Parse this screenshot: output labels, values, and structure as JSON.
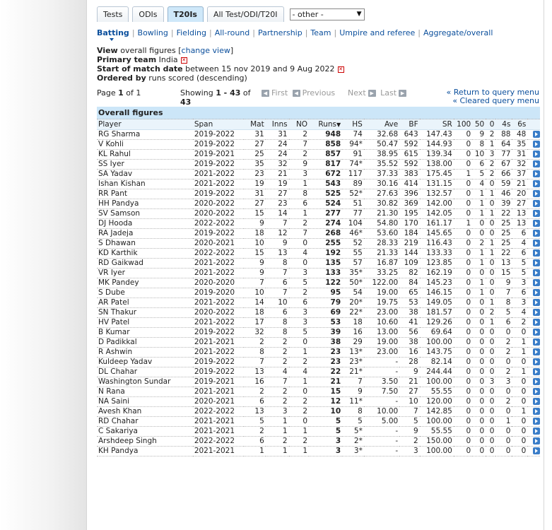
{
  "tabs": [
    "Tests",
    "ODIs",
    "T20Is",
    "All Test/ODI/T20I"
  ],
  "active_tab": "T20Is",
  "select": {
    "value": "- other -"
  },
  "subnav": [
    "Batting",
    "Bowling",
    "Fielding",
    "All-round",
    "Partnership",
    "Team",
    "Umpire and referee",
    "Aggregate/overall"
  ],
  "meta": {
    "view_label": "View",
    "view_text": " overall figures [",
    "change_view": "change view",
    "view_close": "]",
    "team_label": "Primary team",
    "team_value": " India",
    "date_label": "Start of match date",
    "date_value": " between 15 nov 2019 and 9 Aug 2022",
    "order_label": "Ordered by",
    "order_value": " runs scored (descending)"
  },
  "pager": {
    "page_prefix": "Page ",
    "page": "1",
    "of": " of ",
    "total_pages": "1",
    "showing_prefix": "Showing ",
    "showing_range": "1 - 43",
    "showing_of": " of ",
    "showing_total": "43",
    "first": "First",
    "previous": "Previous",
    "next": "Next",
    "last": "Last",
    "return": "Return to query menu",
    "cleared": "Cleared query menu"
  },
  "table": {
    "caption": "Overall figures",
    "headers": [
      "Player",
      "Span",
      "Mat",
      "Inns",
      "NO",
      "Runs",
      "HS",
      "Ave",
      "BF",
      "SR",
      "100",
      "50",
      "0",
      "4s",
      "6s"
    ],
    "rows": [
      [
        "RG Sharma",
        "2019-2022",
        "31",
        "31",
        "2",
        "948",
        "74",
        "32.68",
        "643",
        "147.43",
        "0",
        "9",
        "2",
        "88",
        "48"
      ],
      [
        "V Kohli",
        "2019-2022",
        "27",
        "24",
        "7",
        "858",
        "94*",
        "50.47",
        "592",
        "144.93",
        "0",
        "8",
        "1",
        "64",
        "35"
      ],
      [
        "KL Rahul",
        "2019-2021",
        "25",
        "24",
        "2",
        "857",
        "91",
        "38.95",
        "615",
        "139.34",
        "0",
        "10",
        "3",
        "77",
        "31"
      ],
      [
        "SS Iyer",
        "2019-2022",
        "35",
        "32",
        "9",
        "817",
        "74*",
        "35.52",
        "592",
        "138.00",
        "0",
        "6",
        "2",
        "67",
        "32"
      ],
      [
        "SA Yadav",
        "2021-2022",
        "23",
        "21",
        "3",
        "672",
        "117",
        "37.33",
        "383",
        "175.45",
        "1",
        "5",
        "2",
        "66",
        "37"
      ],
      [
        "Ishan Kishan",
        "2021-2022",
        "19",
        "19",
        "1",
        "543",
        "89",
        "30.16",
        "414",
        "131.15",
        "0",
        "4",
        "0",
        "59",
        "21"
      ],
      [
        "RR Pant",
        "2019-2022",
        "31",
        "27",
        "8",
        "525",
        "52*",
        "27.63",
        "396",
        "132.57",
        "0",
        "1",
        "1",
        "46",
        "20"
      ],
      [
        "HH Pandya",
        "2020-2022",
        "27",
        "23",
        "6",
        "524",
        "51",
        "30.82",
        "369",
        "142.00",
        "0",
        "1",
        "0",
        "39",
        "27"
      ],
      [
        "SV Samson",
        "2020-2022",
        "15",
        "14",
        "1",
        "277",
        "77",
        "21.30",
        "195",
        "142.05",
        "0",
        "1",
        "1",
        "22",
        "13"
      ],
      [
        "DJ Hooda",
        "2022-2022",
        "9",
        "7",
        "2",
        "274",
        "104",
        "54.80",
        "170",
        "161.17",
        "1",
        "0",
        "0",
        "25",
        "13"
      ],
      [
        "RA Jadeja",
        "2019-2022",
        "18",
        "12",
        "7",
        "268",
        "46*",
        "53.60",
        "184",
        "145.65",
        "0",
        "0",
        "0",
        "25",
        "6"
      ],
      [
        "S Dhawan",
        "2020-2021",
        "10",
        "9",
        "0",
        "255",
        "52",
        "28.33",
        "219",
        "116.43",
        "0",
        "2",
        "1",
        "25",
        "4"
      ],
      [
        "KD Karthik",
        "2022-2022",
        "15",
        "13",
        "4",
        "192",
        "55",
        "21.33",
        "144",
        "133.33",
        "0",
        "1",
        "1",
        "22",
        "6"
      ],
      [
        "RD Gaikwad",
        "2021-2022",
        "9",
        "8",
        "0",
        "135",
        "57",
        "16.87",
        "109",
        "123.85",
        "0",
        "1",
        "0",
        "13",
        "5"
      ],
      [
        "VR Iyer",
        "2021-2022",
        "9",
        "7",
        "3",
        "133",
        "35*",
        "33.25",
        "82",
        "162.19",
        "0",
        "0",
        "0",
        "15",
        "5"
      ],
      [
        "MK Pandey",
        "2020-2020",
        "7",
        "6",
        "5",
        "122",
        "50*",
        "122.00",
        "84",
        "145.23",
        "0",
        "1",
        "0",
        "9",
        "3"
      ],
      [
        "S Dube",
        "2019-2020",
        "10",
        "7",
        "2",
        "95",
        "54",
        "19.00",
        "65",
        "146.15",
        "0",
        "1",
        "0",
        "7",
        "6"
      ],
      [
        "AR Patel",
        "2021-2022",
        "14",
        "10",
        "6",
        "79",
        "20*",
        "19.75",
        "53",
        "149.05",
        "0",
        "0",
        "1",
        "8",
        "3"
      ],
      [
        "SN Thakur",
        "2020-2022",
        "18",
        "6",
        "3",
        "69",
        "22*",
        "23.00",
        "38",
        "181.57",
        "0",
        "0",
        "2",
        "5",
        "4"
      ],
      [
        "HV Patel",
        "2021-2022",
        "17",
        "8",
        "3",
        "53",
        "18",
        "10.60",
        "41",
        "129.26",
        "0",
        "0",
        "1",
        "6",
        "2"
      ],
      [
        "B Kumar",
        "2019-2022",
        "32",
        "8",
        "5",
        "39",
        "16",
        "13.00",
        "56",
        "69.64",
        "0",
        "0",
        "0",
        "0",
        "0"
      ],
      [
        "D Padikkal",
        "2021-2021",
        "2",
        "2",
        "0",
        "38",
        "29",
        "19.00",
        "38",
        "100.00",
        "0",
        "0",
        "0",
        "2",
        "1"
      ],
      [
        "R Ashwin",
        "2021-2022",
        "8",
        "2",
        "1",
        "23",
        "13*",
        "23.00",
        "16",
        "143.75",
        "0",
        "0",
        "0",
        "2",
        "1"
      ],
      [
        "Kuldeep Yadav",
        "2019-2022",
        "7",
        "2",
        "2",
        "23",
        "23*",
        "-",
        "28",
        "82.14",
        "0",
        "0",
        "0",
        "0",
        "0"
      ],
      [
        "DL Chahar",
        "2019-2022",
        "13",
        "4",
        "4",
        "22",
        "21*",
        "-",
        "9",
        "244.44",
        "0",
        "0",
        "0",
        "2",
        "1"
      ],
      [
        "Washington Sundar",
        "2019-2021",
        "16",
        "7",
        "1",
        "21",
        "7",
        "3.50",
        "21",
        "100.00",
        "0",
        "0",
        "3",
        "3",
        "0"
      ],
      [
        "N Rana",
        "2021-2021",
        "2",
        "2",
        "0",
        "15",
        "9",
        "7.50",
        "27",
        "55.55",
        "0",
        "0",
        "0",
        "0",
        "0"
      ],
      [
        "NA Saini",
        "2020-2021",
        "6",
        "2",
        "2",
        "12",
        "11*",
        "-",
        "10",
        "120.00",
        "0",
        "0",
        "0",
        "2",
        "0"
      ],
      [
        "Avesh Khan",
        "2022-2022",
        "13",
        "3",
        "2",
        "10",
        "8",
        "10.00",
        "7",
        "142.85",
        "0",
        "0",
        "0",
        "0",
        "1"
      ],
      [
        "RD Chahar",
        "2021-2021",
        "5",
        "1",
        "0",
        "5",
        "5",
        "5.00",
        "5",
        "100.00",
        "0",
        "0",
        "0",
        "1",
        "0"
      ],
      [
        "C Sakariya",
        "2021-2021",
        "2",
        "1",
        "1",
        "5",
        "5*",
        "-",
        "9",
        "55.55",
        "0",
        "0",
        "0",
        "0",
        "0"
      ],
      [
        "Arshdeep Singh",
        "2022-2022",
        "6",
        "2",
        "2",
        "3",
        "2*",
        "-",
        "2",
        "150.00",
        "0",
        "0",
        "0",
        "0",
        "0"
      ],
      [
        "KH Pandya",
        "2021-2021",
        "1",
        "1",
        "1",
        "3",
        "3*",
        "-",
        "3",
        "100.00",
        "0",
        "0",
        "0",
        "0",
        "0"
      ]
    ]
  }
}
